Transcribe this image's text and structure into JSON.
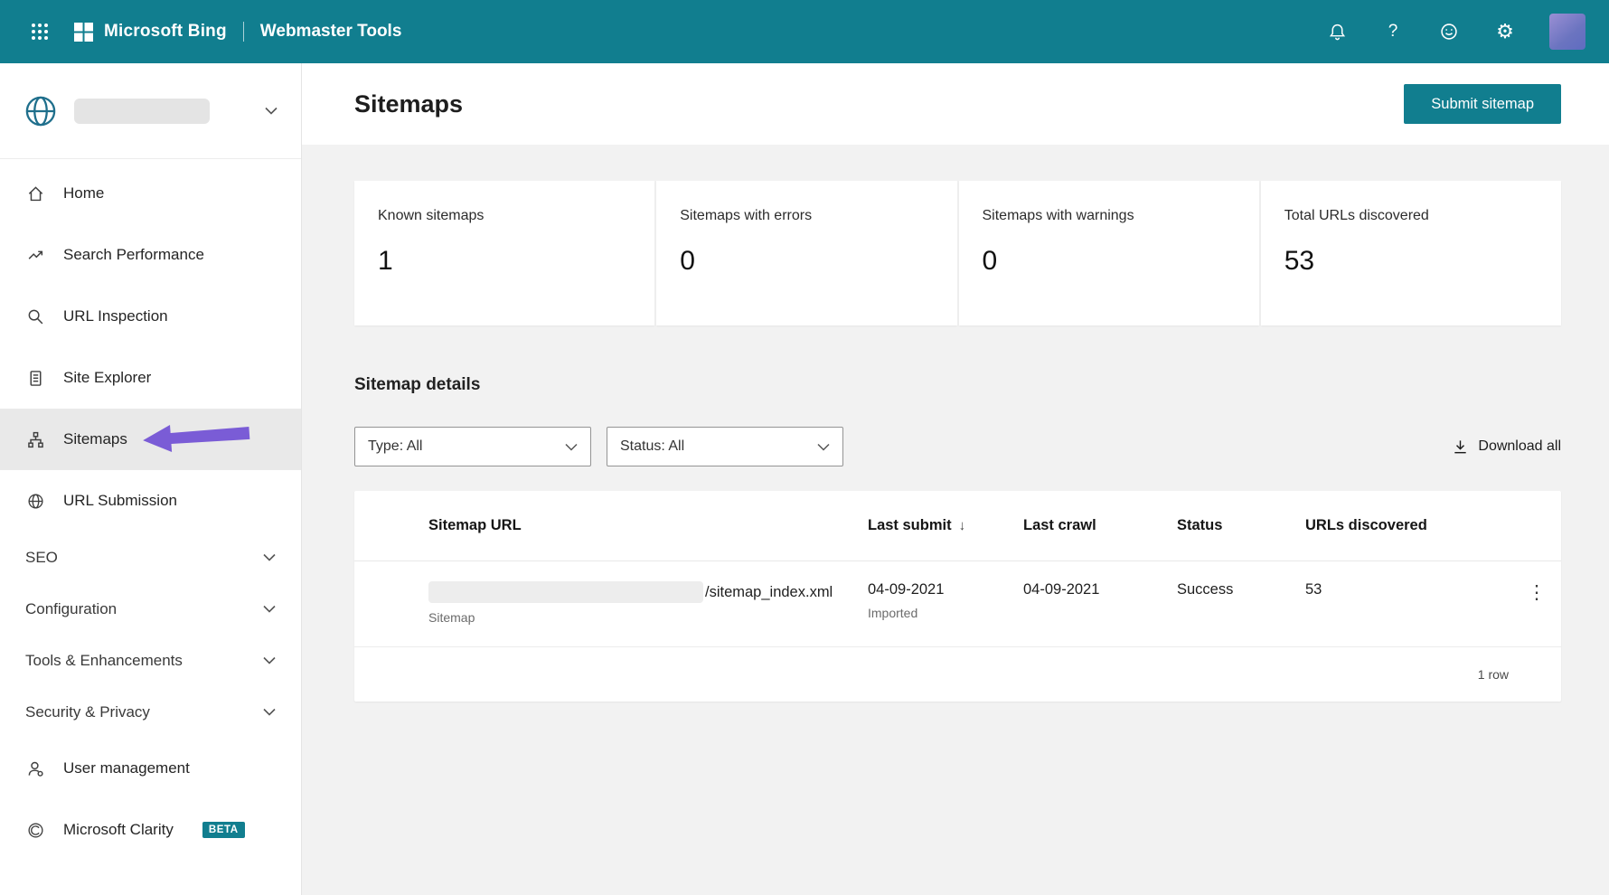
{
  "colors": {
    "topbar": "#117E8F",
    "accent": "#117E8F",
    "beta_badge": "#117E8F",
    "selected_item_bg": "#E9E9E9",
    "annotation_arrow": "#7A5CD6"
  },
  "icons": {
    "question": "?",
    "gear": "⚙",
    "kebab": "⋮",
    "sort_desc": "↓"
  },
  "topbar": {
    "brand": "Microsoft Bing",
    "product": "Webmaster Tools"
  },
  "sidebar": {
    "items": [
      {
        "label": "Home"
      },
      {
        "label": "Search Performance"
      },
      {
        "label": "URL Inspection"
      },
      {
        "label": "Site Explorer"
      },
      {
        "label": "Sitemaps",
        "selected": true
      },
      {
        "label": "URL Submission"
      },
      {
        "label": "SEO",
        "expandable": true
      },
      {
        "label": "Configuration",
        "expandable": true
      },
      {
        "label": "Tools & Enhancements",
        "expandable": true
      },
      {
        "label": "Security & Privacy",
        "expandable": true
      },
      {
        "label": "User management"
      },
      {
        "label": "Microsoft Clarity",
        "badge": "BETA"
      }
    ]
  },
  "main": {
    "title": "Sitemaps",
    "submit_button": "Submit sitemap",
    "stats": [
      {
        "label": "Known sitemaps",
        "value": "1"
      },
      {
        "label": "Sitemaps with errors",
        "value": "0"
      },
      {
        "label": "Sitemaps with warnings",
        "value": "0"
      },
      {
        "label": "Total URLs discovered",
        "value": "53"
      }
    ],
    "details": {
      "title": "Sitemap details",
      "filters": [
        {
          "label": "Type: All"
        },
        {
          "label": "Status: All"
        }
      ],
      "download_all": "Download all",
      "table": {
        "headers": [
          "Sitemap URL",
          "Last submit",
          "Last crawl",
          "Status",
          "URLs discovered"
        ],
        "rows": [
          {
            "url_suffix": "/sitemap_index.xml",
            "url_type": "Sitemap",
            "last_submit": "04-09-2021",
            "last_submit_sub": "Imported",
            "last_crawl": "04-09-2021",
            "status": "Success",
            "urls_discovered": "53"
          }
        ],
        "footer": "1 row"
      }
    }
  }
}
